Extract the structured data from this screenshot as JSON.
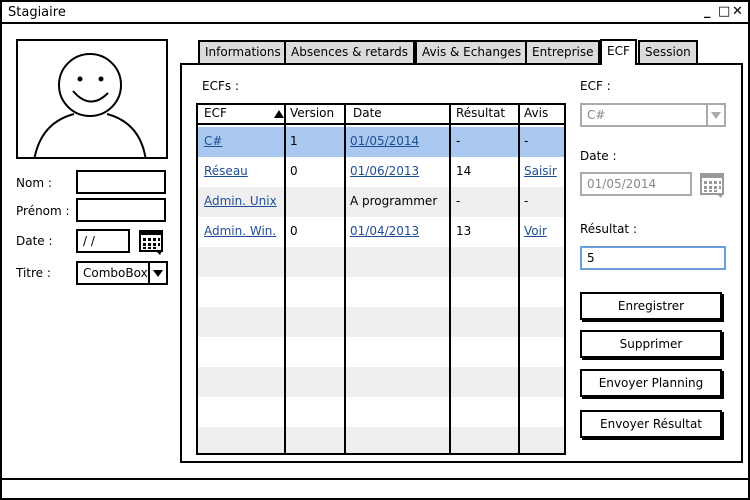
{
  "window": {
    "title": "Stagiaire",
    "controls": {
      "minimize": "_",
      "maximize": "□",
      "close": "✕"
    }
  },
  "left_form": {
    "nom_label": "Nom :",
    "prenom_label": "Prénom :",
    "date_label": "Date :",
    "date_value": " / /",
    "titre_label": "Titre :",
    "titre_value": "ComboBox"
  },
  "tabs": [
    {
      "label": "Informations",
      "active": false
    },
    {
      "label": "Absences & retards",
      "active": false
    },
    {
      "label": "Avis & Echanges",
      "active": false
    },
    {
      "label": "Entreprise",
      "active": false
    },
    {
      "label": "ECF",
      "active": true
    },
    {
      "label": "Session",
      "active": false
    }
  ],
  "ecf_panel": {
    "list_label": "ECFs :",
    "columns": [
      "ECF",
      "Version",
      "Date",
      "Résultat",
      "Avis"
    ],
    "rows": [
      {
        "ecf": "C#",
        "version": "1",
        "date": "01/05/2014",
        "resultat": "-",
        "avis": "-",
        "selected": true
      },
      {
        "ecf": "Réseau",
        "version": "0",
        "date": "01/06/2013",
        "resultat": "14",
        "avis": "Saisir"
      },
      {
        "ecf": "Admin. Unix",
        "version": "",
        "date": "A programmer",
        "resultat": "-",
        "avis": "-"
      },
      {
        "ecf": "Admin. Win.",
        "version": "0",
        "date": "01/04/2013",
        "resultat": "13",
        "avis": "Voir"
      }
    ],
    "ecf_label": "ECF :",
    "ecf_value": "C#",
    "date_label": "Date :",
    "date_value": "01/05/2014",
    "resultat_label": "Résultat :",
    "resultat_value": "5",
    "buttons": {
      "save": "Enregistrer",
      "delete": "Supprimer",
      "send_planning": "Envoyer Planning",
      "send_result": "Envoyer Résultat"
    }
  },
  "colors": {
    "selected_row": "#a8c8ef",
    "link": "#1f4e96",
    "focus_border": "#6a9fd8",
    "tab_inactive": "#dcdcdc"
  }
}
